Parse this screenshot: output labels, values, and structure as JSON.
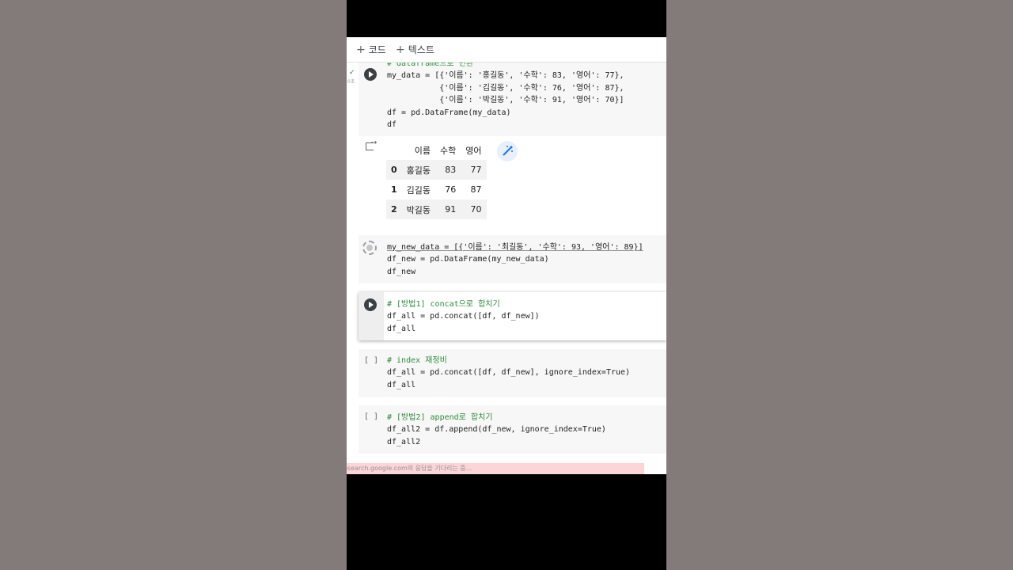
{
  "toolbar": {
    "code_label": "코드",
    "text_label": "텍스트",
    "plus": "+"
  },
  "cell1": {
    "exec_time": "0초",
    "lines": [
      "# dataframe으로 변환",
      "my_data = [{'이름': '홍길동', '수학': 83, '영어': 77},",
      "           {'이름': '김길동', '수학': 76, '영어': 87},",
      "           {'이름': '박길동', '수학': 91, '영어': 70}]",
      "df = pd.DataFrame(my_data)",
      "df"
    ]
  },
  "output_table": {
    "columns": [
      "",
      "이름",
      "수학",
      "영어"
    ],
    "rows": [
      {
        "index": "0",
        "name": "홍길동",
        "math": "83",
        "english": "77"
      },
      {
        "index": "1",
        "name": "김길동",
        "math": "76",
        "english": "87"
      },
      {
        "index": "2",
        "name": "박길동",
        "math": "91",
        "english": "70"
      }
    ]
  },
  "cell2": {
    "lines": [
      "my_new_data = [{'이름': '최길동', '수학': 93, '영어': 89}]",
      "df_new = pd.DataFrame(my_new_data)",
      "df_new"
    ]
  },
  "cell3": {
    "lines": [
      "# [방법1] concat으로 합치기",
      "df_all = pd.concat([df, df_new])",
      "df_all"
    ]
  },
  "cell4": {
    "bracket": "[ ]",
    "lines": [
      "# index 재정비",
      "df_all = pd.concat([df, df_new], ignore_index=True)",
      "df_all"
    ]
  },
  "cell5": {
    "bracket": "[ ]",
    "lines": [
      "# [방법2] append로 합치기",
      "df_all2 = df.append(df_new, ignore_index=True)",
      "df_all2"
    ]
  },
  "status_bar": {
    "text": "esearch.google.com의 응답을 기다리는 중..."
  }
}
